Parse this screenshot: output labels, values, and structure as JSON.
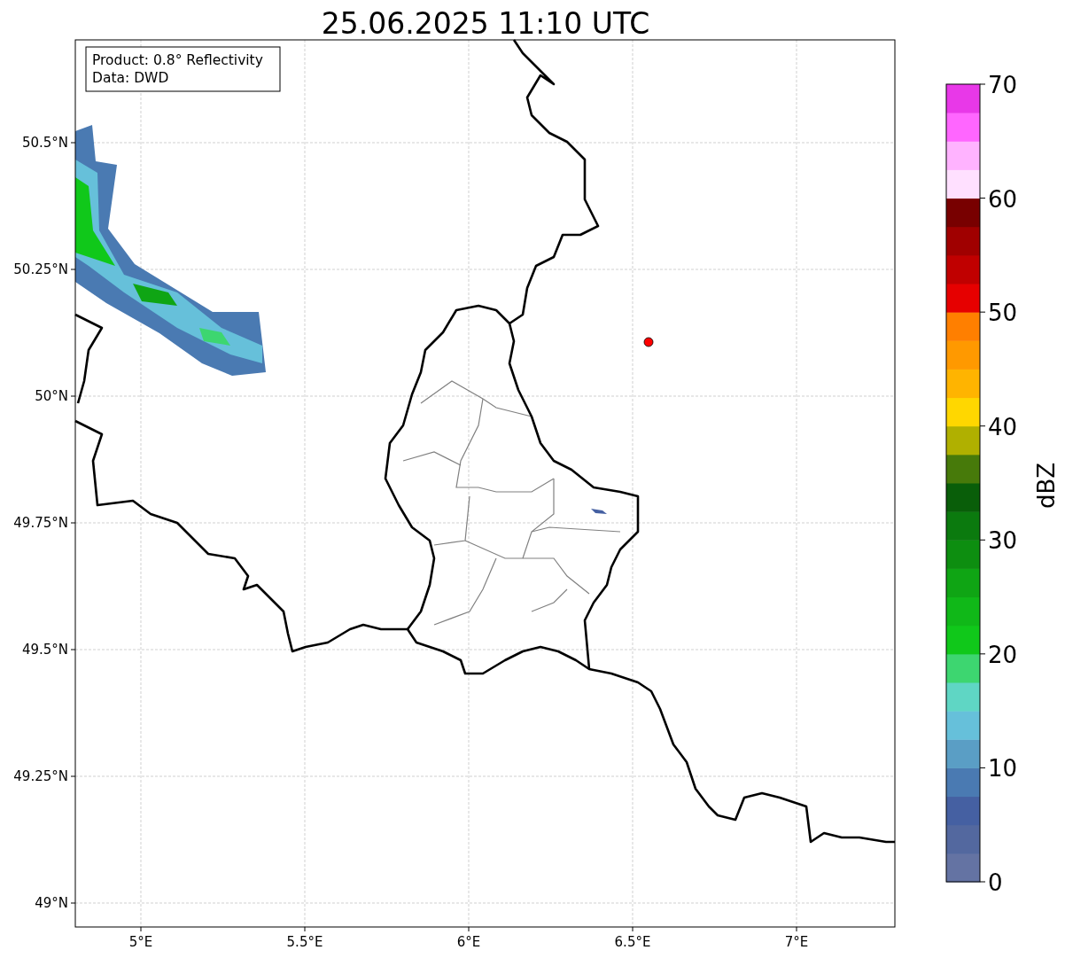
{
  "title": "25.06.2025 11:10 UTC",
  "info_box": {
    "lines": [
      "Product: 0.8° Reflectivity",
      "Data: DWD"
    ]
  },
  "map": {
    "lat_ticks": [
      "50.5°N",
      "50.25°N",
      "50°N",
      "49.75°N",
      "49.5°N",
      "49.25°N",
      "49°N"
    ],
    "lon_ticks": [
      "5°E",
      "5.5°E",
      "6°E",
      "6.5°E",
      "7°E"
    ],
    "marker": {
      "color": "#ff0000"
    }
  },
  "colorbar": {
    "label": "dBZ",
    "ticks": [
      "70",
      "60",
      "50",
      "40",
      "30",
      "20",
      "10",
      "0"
    ],
    "segments": [
      {
        "color": "#6473a3"
      },
      {
        "color": "#53689f"
      },
      {
        "color": "#4560a2"
      },
      {
        "color": "#4a7ab2"
      },
      {
        "color": "#5a9ec5"
      },
      {
        "color": "#66c0da"
      },
      {
        "color": "#5fd6c4"
      },
      {
        "color": "#3dd670"
      },
      {
        "color": "#10c81a"
      },
      {
        "color": "#10b818"
      },
      {
        "color": "#0fa514"
      },
      {
        "color": "#0d8e10"
      },
      {
        "color": "#0b7a0e"
      },
      {
        "color": "#095e09"
      },
      {
        "color": "#477a0a"
      },
      {
        "color": "#b0b000"
      },
      {
        "color": "#ffd700"
      },
      {
        "color": "#ffb400"
      },
      {
        "color": "#ff9900"
      },
      {
        "color": "#ff7f00"
      },
      {
        "color": "#e60000"
      },
      {
        "color": "#c00000"
      },
      {
        "color": "#a00000"
      },
      {
        "color": "#780000"
      },
      {
        "color": "#ffe0ff"
      },
      {
        "color": "#ffb3ff"
      },
      {
        "color": "#ff66ff"
      },
      {
        "color": "#e838e8"
      }
    ]
  }
}
